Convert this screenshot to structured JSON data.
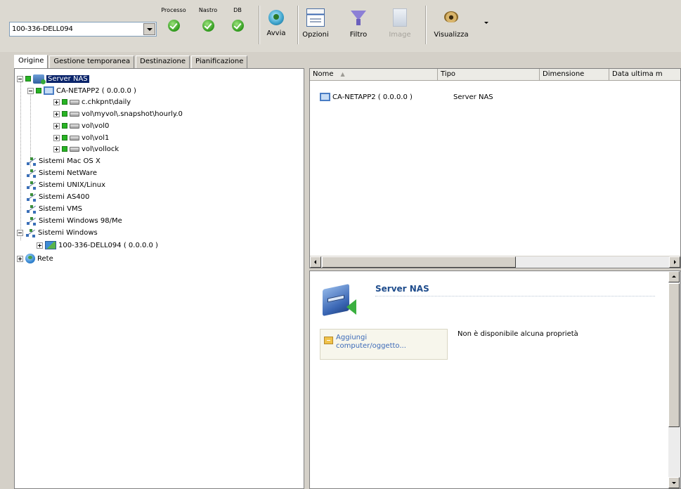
{
  "toolbar": {
    "server_select": "100-336-DELL094",
    "status": [
      {
        "label": "Processo"
      },
      {
        "label": "Nastro"
      },
      {
        "label": "DB"
      }
    ],
    "buttons": {
      "avvia": "Avvia",
      "opzioni": "Opzioni",
      "filtro": "Filtro",
      "image": "Image",
      "visualizza": "Visualizza"
    }
  },
  "tabs": [
    "Origine",
    "Gestione temporanea",
    "Destinazione",
    "Pianificazione"
  ],
  "tree": {
    "server_nas": "Server NAS",
    "netapp": "CA-NETAPP2 ( 0.0.0.0 )",
    "vol1": "c.chkpnt\\daily",
    "vol2": "vol\\myvol\\.snapshot\\hourly.0",
    "vol3": "vol\\vol0",
    "vol4": "vol\\vol1",
    "vol5": "vol\\vollock",
    "mac": "Sistemi Mac OS X",
    "netware": "Sistemi NetWare",
    "unix": "Sistemi UNIX/Linux",
    "as400": "Sistemi AS400",
    "vms": "Sistemi VMS",
    "win98": "Sistemi Windows 98/Me",
    "windows": "Sistemi Windows",
    "dell": "100-336-DELL094 ( 0.0.0.0 )",
    "rete": "Rete"
  },
  "list": {
    "columns": [
      "Nome",
      "Tipo",
      "Dimensione",
      "Data ultima m"
    ],
    "row": {
      "name": "CA-NETAPP2 ( 0.0.0.0 )",
      "type": "Server NAS"
    }
  },
  "detail": {
    "title": "Server NAS",
    "add_line1": "Aggiungi",
    "add_line2": "computer/oggetto...",
    "no_properties": "Non è disponibile alcuna proprietà"
  },
  "colors": {
    "selection": "#0a246a",
    "status_ok": "#2f9a1c",
    "link": "#3c6ab8",
    "detail_title": "#1e4c8c"
  }
}
